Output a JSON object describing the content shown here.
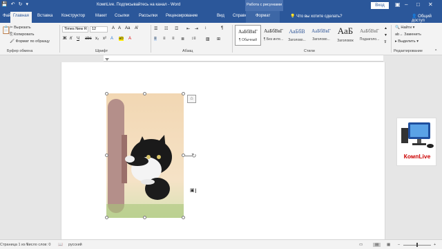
{
  "title_bar": {
    "document_title": "КомпLive. Подписывайтесь на канал - Word",
    "context_group": "Работа с рисунками",
    "login_label": "Вход",
    "undo_icon": "undo-icon",
    "redo_icon": "redo-icon"
  },
  "tabs": {
    "file": "Файл",
    "home": "Главная",
    "insert": "Вставка",
    "design": "Конструктор",
    "layout": "Макет",
    "references": "Ссылки",
    "mailings": "Рассылки",
    "review": "Рецензирование",
    "view": "Вид",
    "help": "Справка",
    "format": "Формат",
    "tell_me": "Что вы хотите сделать?",
    "share": "Общий доступ"
  },
  "clipboard": {
    "cut": "Вырезать",
    "copy": "Копировать",
    "format_painter": "Формат по образцу",
    "group_label": "Буфер обмена"
  },
  "font": {
    "font_name": "Times New R",
    "font_size": "12",
    "group_label": "Шрифт"
  },
  "paragraph": {
    "group_label": "Абзац"
  },
  "styles": {
    "group_label": "Стили",
    "items": [
      {
        "sample": "АаБбВвГ",
        "name": "¶ Обычный"
      },
      {
        "sample": "АаБбВвГ",
        "name": "¶ Без инте..."
      },
      {
        "sample": "АаБбВ",
        "name": "Заголово..."
      },
      {
        "sample": "АаБбВвГ",
        "name": "Заголово..."
      },
      {
        "sample": "АаБ",
        "name": "Заголовок"
      },
      {
        "sample": "АаБбВвГ",
        "name": "Подзаголо..."
      }
    ]
  },
  "editing": {
    "find": "Найти",
    "replace": "Заменить",
    "select": "Выделить",
    "group_label": "Редактирование"
  },
  "logo": {
    "text": "КомпLive"
  },
  "status": {
    "page": "Страница 1 из 1",
    "words": "Число слов: 0",
    "language": "русский"
  }
}
